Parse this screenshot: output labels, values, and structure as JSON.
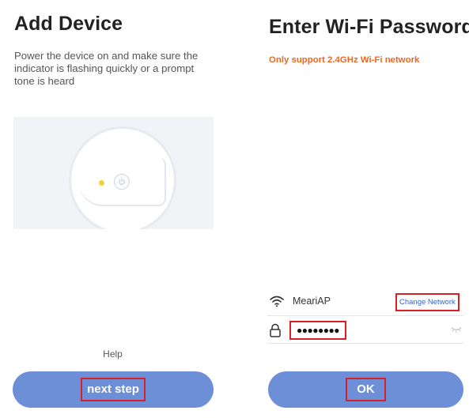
{
  "left_screen": {
    "title": "Add Device",
    "instructions": "Power the device on and make sure the indicator is flashing quickly or a prompt tone is heard",
    "help_label": "Help",
    "next_button_label": "next step",
    "led_color": "#f2d23c"
  },
  "right_screen": {
    "title": "Enter Wi-Fi Password",
    "warning": "Only support 2.4GHz Wi-Fi network",
    "network_name": "MeariAP",
    "change_network_label": "Change Network",
    "password_masked": "●●●●●●●●",
    "ok_button_label": "OK"
  },
  "colors": {
    "button_blue": "#6d8fd8",
    "warning_orange": "#f0661e",
    "highlight_red": "#d92026",
    "link_blue": "#3a66c4"
  }
}
